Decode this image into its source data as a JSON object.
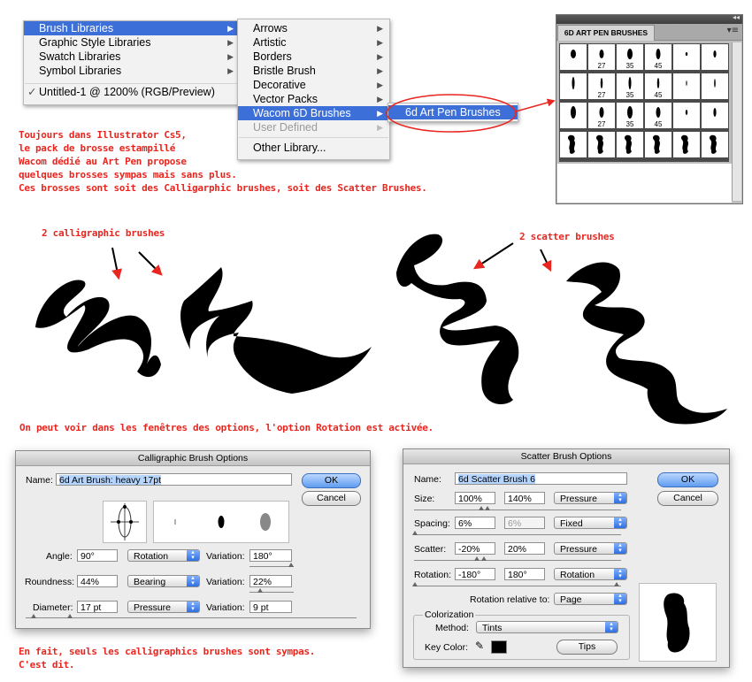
{
  "menu1": {
    "items": [
      {
        "label": "Brush Libraries",
        "selected": true,
        "submenu": true
      },
      {
        "label": "Graphic Style Libraries",
        "submenu": true
      },
      {
        "label": "Swatch Libraries",
        "submenu": true
      },
      {
        "label": "Symbol Libraries",
        "submenu": true
      }
    ],
    "document": "Untitled-1 @ 1200% (RGB/Preview)",
    "check": "✓"
  },
  "menu2": {
    "items": [
      {
        "label": "Arrows"
      },
      {
        "label": "Artistic"
      },
      {
        "label": "Borders"
      },
      {
        "label": "Bristle Brush"
      },
      {
        "label": "Decorative"
      },
      {
        "label": "Vector Packs"
      },
      {
        "label": "Wacom 6D Brushes",
        "selected": true
      },
      {
        "label": "User Defined",
        "disabled": true
      }
    ],
    "other": "Other Library..."
  },
  "menu3": {
    "item": "6d Art Pen Brushes"
  },
  "panel": {
    "tab": "6D ART PEN BRUSHES",
    "collapse_icon": "double-arrow",
    "menu_icon": "panel-menu",
    "sizes": [
      "27",
      "35",
      "45"
    ]
  },
  "notes": {
    "intro": "Toujours dans Illustrator Cs5,\nle pack de brosse estampillé\nWacom dédié au Art Pen propose\nquelques brosses sympas mais sans plus.\nCes brosses sont soit des Calligarphic brushes, soit des Scatter Brushes.",
    "calligraphic": "2 calligraphic brushes",
    "scatter": "2 scatter brushes",
    "options": "On peut voir dans les fenêtres des options, l'option Rotation est activée.",
    "conclusion": "En fait, seuls les calligraphics brushes sont sympas.\nC'est dit."
  },
  "calligraphic_dialog": {
    "title": "Calligraphic Brush Options",
    "name_label": "Name:",
    "name_value": "6d Art Brush: heavy 17pt",
    "ok": "OK",
    "cancel": "Cancel",
    "angle_label": "Angle:",
    "angle_value": "90°",
    "angle_mode": "Rotation",
    "angle_var_label": "Variation:",
    "angle_var": "180°",
    "roundness_label": "Roundness:",
    "roundness_value": "44%",
    "roundness_mode": "Bearing",
    "roundness_var_label": "Variation:",
    "roundness_var": "22%",
    "diameter_label": "Diameter:",
    "diameter_value": "17 pt",
    "diameter_mode": "Pressure",
    "diameter_var_label": "Variation:",
    "diameter_var": "9 pt"
  },
  "scatter_dialog": {
    "title": "Scatter Brush Options",
    "name_label": "Name:",
    "name_value": "6d Scatter Brush 6",
    "ok": "OK",
    "cancel": "Cancel",
    "size_label": "Size:",
    "size_min": "100%",
    "size_max": "140%",
    "size_mode": "Pressure",
    "spacing_label": "Spacing:",
    "spacing_min": "6%",
    "spacing_max": "6%",
    "spacing_mode": "Fixed",
    "scatter_label": "Scatter:",
    "scatter_min": "-20%",
    "scatter_max": "20%",
    "scatter_mode": "Pressure",
    "rotation_label": "Rotation:",
    "rotation_min": "-180°",
    "rotation_max": "180°",
    "rotation_mode": "Rotation",
    "relative_label": "Rotation relative to:",
    "relative_value": "Page",
    "colorization_label": "Colorization",
    "method_label": "Method:",
    "method_value": "Tints",
    "keycolor_label": "Key Color:",
    "tips": "Tips"
  },
  "colors": {
    "note_red": "#e8261f",
    "selection_blue": "#3d6fd9"
  }
}
